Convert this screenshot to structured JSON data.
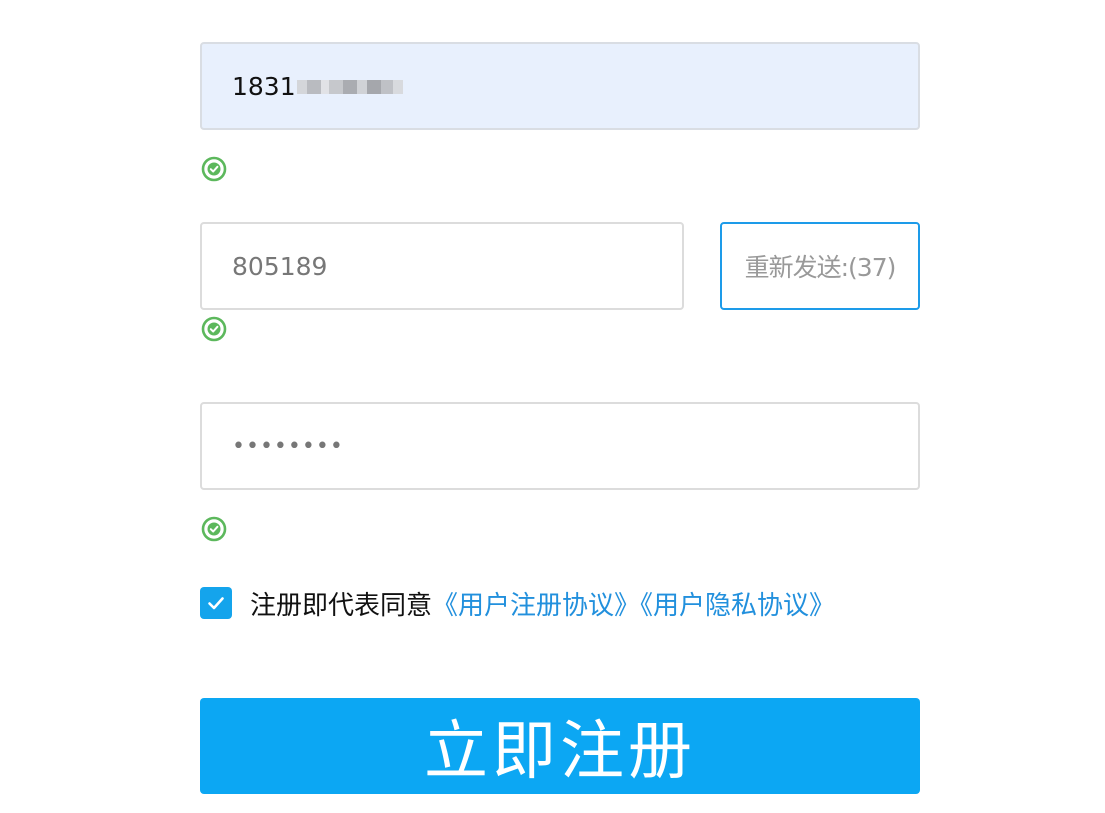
{
  "phone": {
    "value": "1831",
    "masked_digits": 7
  },
  "verification_code": {
    "value": "805189",
    "resend_label": "重新发送:(37)"
  },
  "password": {
    "value": "••••••••"
  },
  "agreement": {
    "checked": true,
    "prefix_text": "注册即代表同意",
    "user_agreement_link": "《用户注册协议》",
    "privacy_link": "《用户隐私协议》"
  },
  "submit": {
    "label": "立即注册"
  },
  "validation": {
    "phone_valid": true,
    "code_valid": true,
    "password_valid": true
  },
  "icons": {
    "valid_check": "check-circle-icon",
    "checkbox_check": "checkmark-icon"
  },
  "colors": {
    "accent": "#0ca7f3",
    "link": "#2290dd",
    "valid_green": "#5cb85c",
    "autofill_bg": "#e8f0fd"
  }
}
